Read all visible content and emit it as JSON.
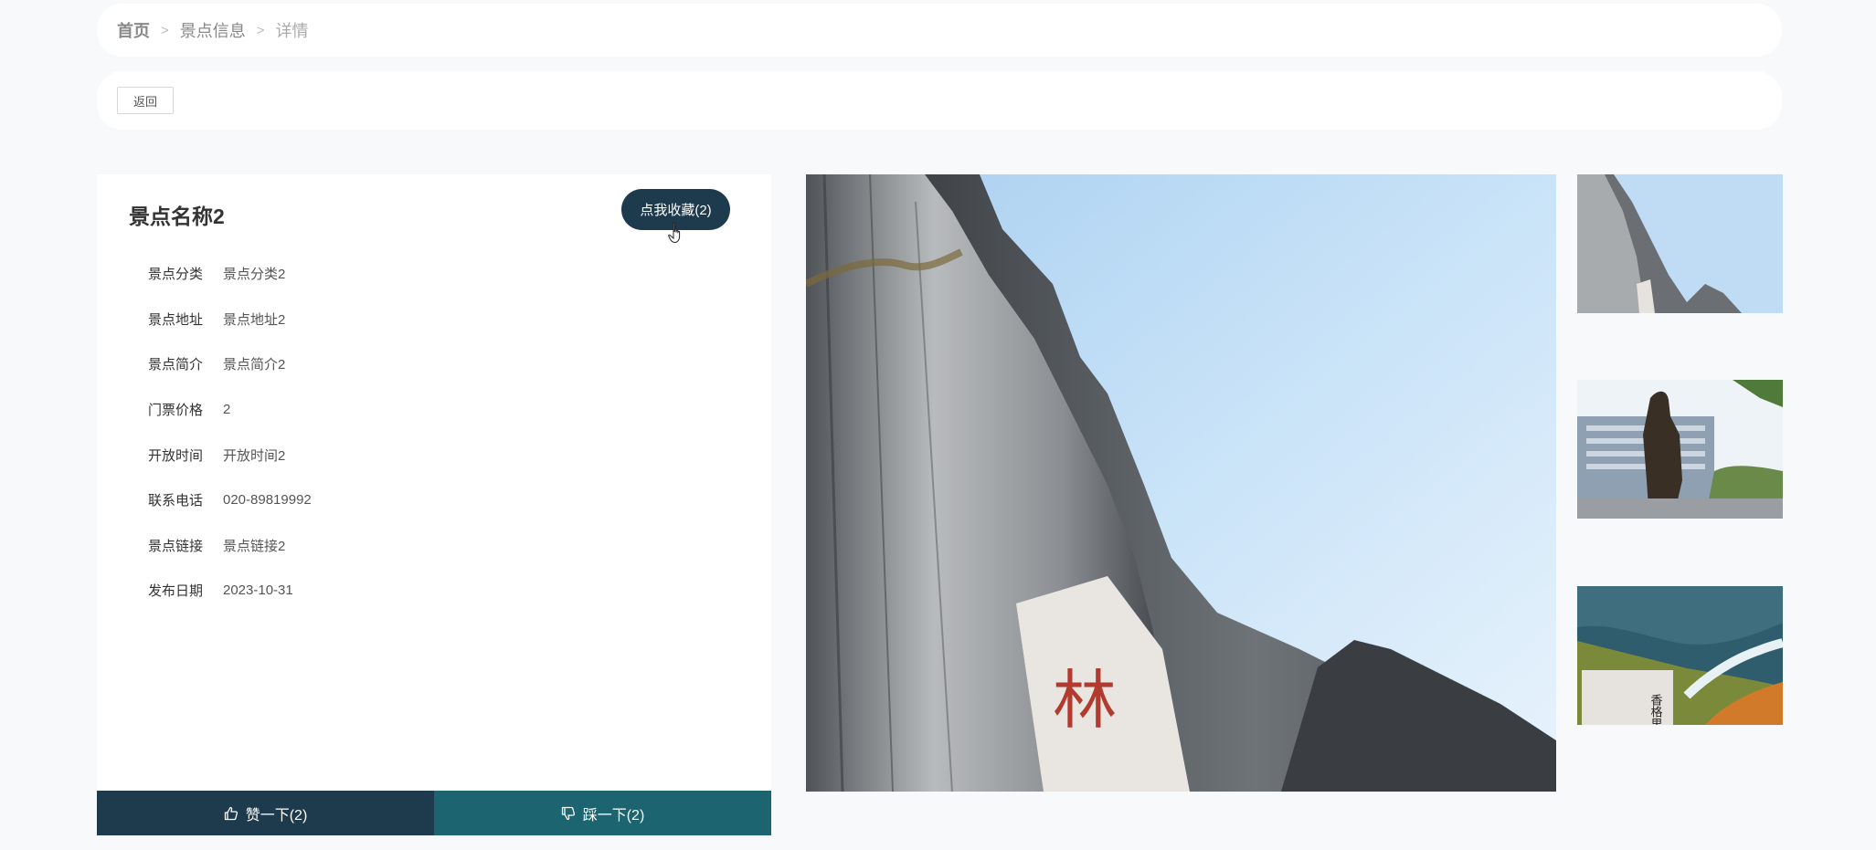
{
  "breadcrumb": {
    "home": "首页",
    "section": "景点信息",
    "current": "详情",
    "separator": ">"
  },
  "toolbar": {
    "back_label": "返回"
  },
  "spot": {
    "name": "景点名称2",
    "favorite_label": "点我收藏(2)",
    "fields": [
      {
        "label": "景点分类",
        "value": "景点分类2"
      },
      {
        "label": "景点地址",
        "value": "景点地址2"
      },
      {
        "label": "景点简介",
        "value": "景点简介2"
      },
      {
        "label": "门票价格",
        "value": "2"
      },
      {
        "label": "开放时间",
        "value": "开放时间2"
      },
      {
        "label": "联系电话",
        "value": "020-89819992"
      },
      {
        "label": "景点链接",
        "value": "景点链接2"
      },
      {
        "label": "发布日期",
        "value": "2023-10-31"
      }
    ]
  },
  "votes": {
    "like_label": "赞一下(2)",
    "dislike_label": "踩一下(2)"
  },
  "gallery": {
    "main_caption_text": "林",
    "thumb3_caption_text": "香格里"
  },
  "colors": {
    "primary": "#1e3a4d",
    "secondary": "#1b6470",
    "background": "#f8f9fa"
  }
}
